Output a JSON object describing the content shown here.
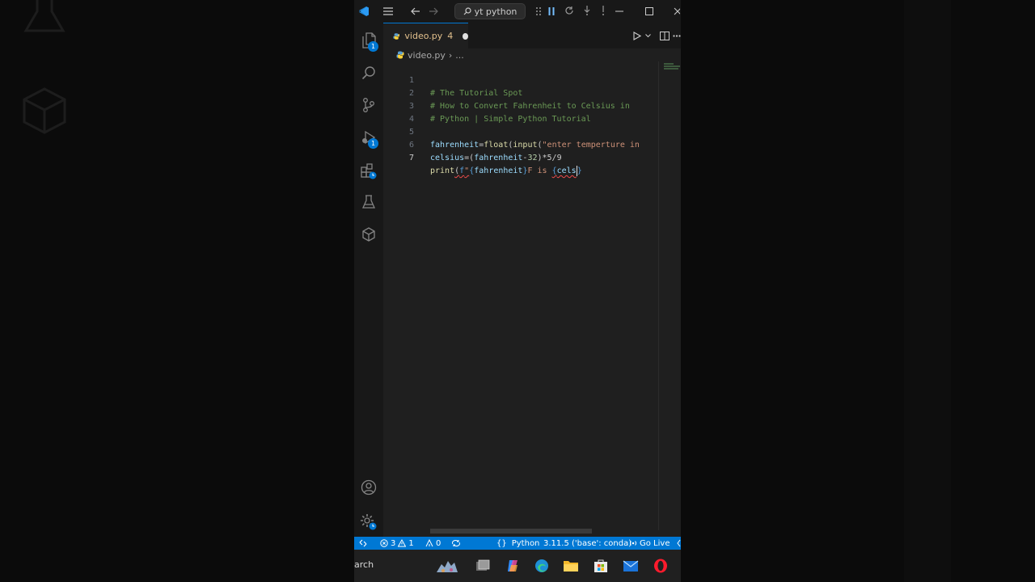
{
  "titlebar": {
    "search_label": "yt python",
    "icons": [
      "vscode-logo-icon",
      "menu-icon",
      "back-icon",
      "forward-icon",
      "search-icon",
      "drag-grip-icon",
      "pause-icon",
      "restart-icon",
      "step-over-icon",
      "step-into-icon",
      "minimize-icon",
      "maximize-icon",
      "close-icon"
    ]
  },
  "activity_bar": {
    "items": [
      "explorer-icon",
      "search-icon",
      "source-control-icon",
      "run-debug-icon",
      "extensions-icon",
      "testing-icon",
      "remote-explorer-icon",
      "account-icon",
      "settings-icon"
    ],
    "explorer_badge": "1",
    "debug_badge": "1"
  },
  "tab": {
    "filename": "video.py",
    "problems_count": "4"
  },
  "breadcrumb": {
    "file": "video.py",
    "separator": "›",
    "more": "..."
  },
  "editor": {
    "lines": [
      {
        "num": "1",
        "text": "# The Tutorial Spot"
      },
      {
        "num": "2",
        "text": "# How to Convert Fahrenheit to Celsius in"
      },
      {
        "num": "3",
        "text": "# Python | Simple Python Tutorial"
      },
      {
        "num": "4",
        "text": ""
      },
      {
        "num": "5",
        "text": "fahrenheit=float(input(\"enter temperture in"
      },
      {
        "num": "6",
        "text": "celsius=(fahrenheit-32)*5/9"
      },
      {
        "num": "7",
        "text": "print(f\"{fahrenheit}F is {cels}"
      }
    ],
    "active_line": "7"
  },
  "statusbar": {
    "remote_icon": "remote-icon",
    "errors": "3",
    "warnings": "1",
    "ports": "0",
    "language_braces": "{}",
    "language": "Python",
    "interpreter": "3.11.5 ('base': conda)",
    "go_live": "Go Live"
  },
  "taskbar": {
    "search_text": "arch",
    "apps": [
      "widgets-icon",
      "task-view-icon",
      "copilot-icon",
      "edge-icon",
      "file-explorer-icon",
      "store-icon",
      "mail-icon",
      "opera-icon"
    ]
  },
  "colors": {
    "accent": "#0078d4",
    "editor_bg": "#1f1f1f",
    "comment": "#6a9955",
    "variable": "#9cdcfe",
    "function": "#dcdcaa",
    "string": "#ce9178",
    "modified": "#e2c08d"
  }
}
